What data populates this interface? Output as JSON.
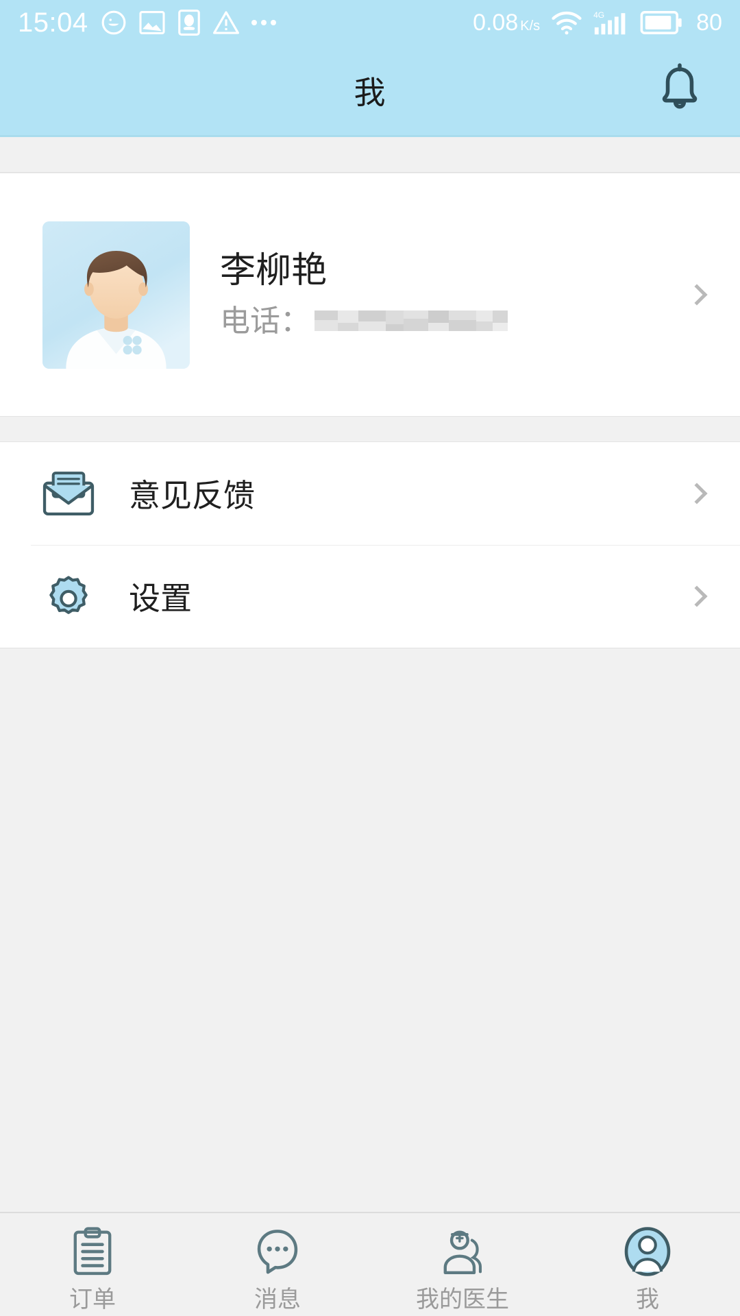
{
  "statusbar": {
    "time": "15:04",
    "network_speed": "0.08",
    "network_speed_unit": "K/s",
    "battery_level": "80",
    "signal_type": "4G",
    "icons": [
      "emoji-smiley-icon",
      "image-icon",
      "qq-penguin-icon",
      "warning-triangle-icon",
      "more-dots-icon",
      "wifi-icon",
      "signal-bars-icon",
      "battery-icon"
    ]
  },
  "header": {
    "title": "我",
    "bell_icon": "notification-bell-icon",
    "background_color": "#b2e3f5"
  },
  "profile": {
    "name": "李柳艳",
    "phone_label": "电话：",
    "phone_value": "",
    "avatar_alt": "doctor-avatar",
    "chevron": "chevron-right-icon"
  },
  "menu": {
    "items": [
      {
        "label": "意见反馈",
        "icon": "envelope-feedback-icon"
      },
      {
        "label": "设置",
        "icon": "gear-settings-icon"
      }
    ]
  },
  "tabbar": {
    "items": [
      {
        "label": "订单",
        "icon": "clipboard-order-icon",
        "active": false
      },
      {
        "label": "消息",
        "icon": "message-bubble-icon",
        "active": false
      },
      {
        "label": "我的医生",
        "icon": "my-doctor-icon",
        "active": false
      },
      {
        "label": "我",
        "icon": "profile-person-icon",
        "active": true
      }
    ]
  },
  "colors": {
    "accent": "#b2e3f5",
    "icon_stroke": "#3f5d66",
    "icon_fill": "#aedcf0",
    "text_primary": "#1f1f1f",
    "text_secondary": "#9b9b9b",
    "page_bg": "#f1f1f1"
  }
}
